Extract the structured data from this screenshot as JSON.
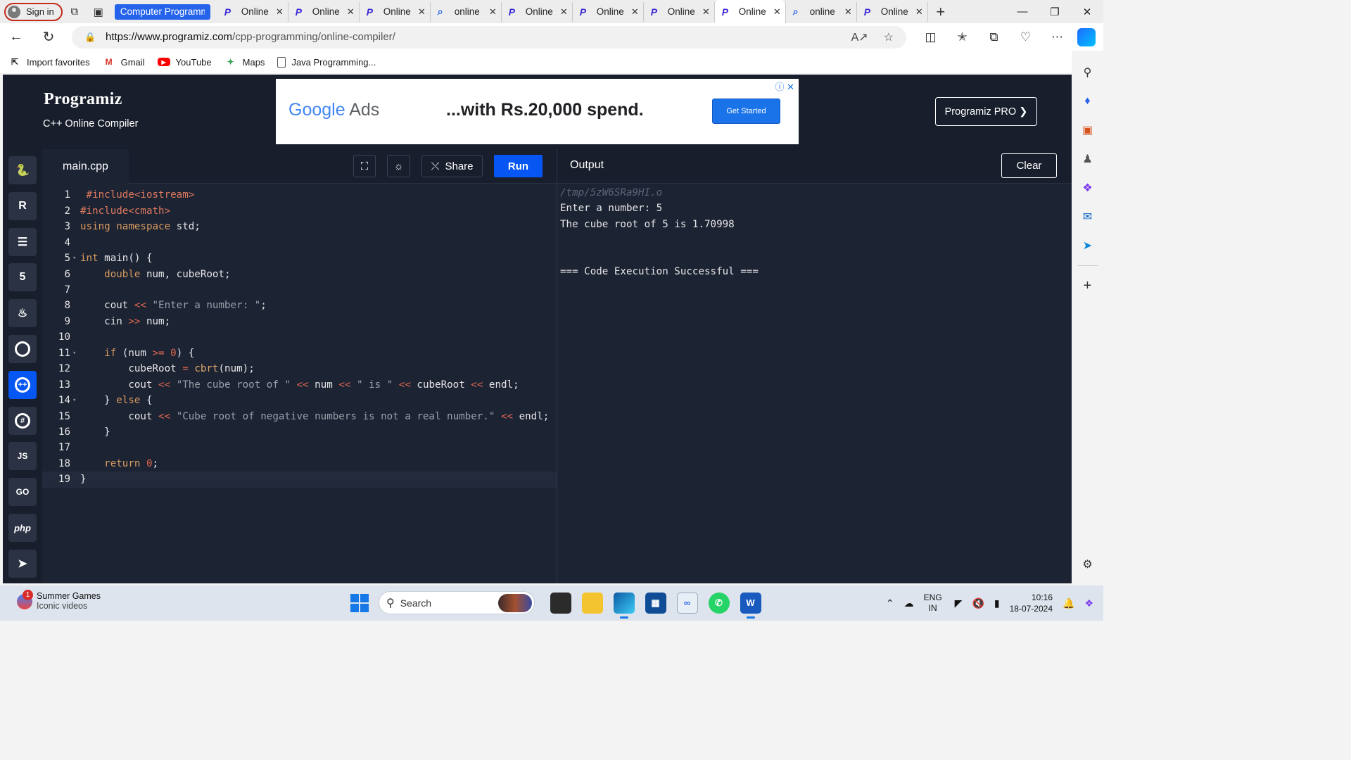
{
  "browser": {
    "signin_label": "Sign in",
    "tabs": [
      {
        "label": "Computer Programmin",
        "icon": "none",
        "style": "first"
      },
      {
        "label": "Online",
        "icon": "programiz"
      },
      {
        "label": "Online",
        "icon": "programiz"
      },
      {
        "label": "Online",
        "icon": "programiz"
      },
      {
        "label": "online",
        "icon": "search"
      },
      {
        "label": "Online",
        "icon": "programiz"
      },
      {
        "label": "Online",
        "icon": "programiz"
      },
      {
        "label": "Online",
        "icon": "programiz"
      },
      {
        "label": "Online",
        "icon": "programiz",
        "active": true
      },
      {
        "label": "online",
        "icon": "search"
      },
      {
        "label": "Online",
        "icon": "programiz"
      }
    ],
    "url_host": "https://www.programiz.com",
    "url_path": "/cpp-programming/online-compiler/",
    "bookmarks": [
      {
        "label": "Import favorites",
        "icon": "import-icon"
      },
      {
        "label": "Gmail",
        "icon": "gmail-icon"
      },
      {
        "label": "YouTube",
        "icon": "youtube-icon"
      },
      {
        "label": "Maps",
        "icon": "maps-icon"
      },
      {
        "label": "Java Programming...",
        "icon": "document-icon"
      }
    ]
  },
  "site": {
    "logo": "Programiz",
    "subtitle": "C++ Online Compiler",
    "pro_button": "Programiz PRO ❯",
    "ad": {
      "brand_google": "Google",
      "brand_ads": "Ads",
      "headline": "...with Rs.20,000 spend.",
      "cta": "Get Started"
    }
  },
  "languages": [
    {
      "name": "python",
      "glyph": "🐍",
      "active": false
    },
    {
      "name": "r",
      "glyph": "R",
      "active": false
    },
    {
      "name": "sql",
      "glyph": "☰",
      "active": false
    },
    {
      "name": "html",
      "glyph": "5",
      "active": false
    },
    {
      "name": "java",
      "glyph": "♨",
      "active": false
    },
    {
      "name": "c",
      "glyph": "C",
      "active": false
    },
    {
      "name": "cpp",
      "glyph": "C",
      "active": true
    },
    {
      "name": "csharp",
      "glyph": "C",
      "active": false
    },
    {
      "name": "js",
      "glyph": "JS",
      "active": false
    },
    {
      "name": "go",
      "glyph": "GO",
      "active": false
    },
    {
      "name": "php",
      "glyph": "php",
      "active": false
    },
    {
      "name": "swift",
      "glyph": "➤",
      "active": false
    }
  ],
  "editor": {
    "filename": "main.cpp",
    "share_label": "Share",
    "run_label": "Run",
    "current_line": 19,
    "lines": [
      {
        "n": "1",
        "fold": "",
        "html": " <span class=\"inc\">#include&lt;iostream&gt;</span>"
      },
      {
        "n": "2",
        "fold": "",
        "html": "<span class=\"inc\">#include&lt;cmath&gt;</span>"
      },
      {
        "n": "3",
        "fold": "",
        "html": "<span class=\"kw\">using namespace</span> std;"
      },
      {
        "n": "4",
        "fold": "",
        "html": ""
      },
      {
        "n": "5",
        "fold": "▾",
        "html": "<span class=\"kw\">int</span> main() {"
      },
      {
        "n": "6",
        "fold": "",
        "html": "    <span class=\"kw\">double</span> num, cubeRoot;"
      },
      {
        "n": "7",
        "fold": "",
        "html": ""
      },
      {
        "n": "8",
        "fold": "",
        "html": "    cout <span class=\"o\">&lt;&lt;</span> <span class=\"s\">\"Enter a number: \"</span>;"
      },
      {
        "n": "9",
        "fold": "",
        "html": "    cin <span class=\"o\">&gt;&gt;</span> num;"
      },
      {
        "n": "10",
        "fold": "",
        "html": ""
      },
      {
        "n": "11",
        "fold": "▾",
        "html": "    <span class=\"kw\">if</span> (num <span class=\"o\">&gt;=</span> <span class=\"n\">0</span>) {"
      },
      {
        "n": "12",
        "fold": "",
        "html": "        cubeRoot <span class=\"o\">=</span> <span class=\"k\">cbrt</span>(num);"
      },
      {
        "n": "13",
        "fold": "",
        "html": "        cout <span class=\"o\">&lt;&lt;</span> <span class=\"s\">\"The cube root of \"</span> <span class=\"o\">&lt;&lt;</span> num <span class=\"o\">&lt;&lt;</span> <span class=\"s\">\" is \"</span> <span class=\"o\">&lt;&lt;</span> cubeRoot <span class=\"o\">&lt;&lt;</span> endl;"
      },
      {
        "n": "14",
        "fold": "▾",
        "html": "    } <span class=\"kw\">else</span> {"
      },
      {
        "n": "15",
        "fold": "",
        "html": "        cout <span class=\"o\">&lt;&lt;</span> <span class=\"s\">\"Cube root of negative numbers is not a real number.\"</span> <span class=\"o\">&lt;&lt;</span> endl;"
      },
      {
        "n": "16",
        "fold": "",
        "html": "    }"
      },
      {
        "n": "17",
        "fold": "",
        "html": ""
      },
      {
        "n": "18",
        "fold": "",
        "html": "    <span class=\"kw\">return</span> <span class=\"n\">0</span>;"
      },
      {
        "n": "19",
        "fold": "",
        "html": "}"
      }
    ]
  },
  "output": {
    "title": "Output",
    "clear_label": "Clear",
    "lines": [
      {
        "text": "/tmp/5zW6SRa9HI.o",
        "kind": "path"
      },
      {
        "text": "Enter a number: 5",
        "kind": "normal"
      },
      {
        "text": "The cube root of 5 is 1.70998",
        "kind": "normal"
      },
      {
        "text": "",
        "kind": "normal"
      },
      {
        "text": "",
        "kind": "normal"
      },
      {
        "text": "=== Code Execution Successful ===",
        "kind": "normal"
      }
    ]
  },
  "taskbar": {
    "weather_badge": "1",
    "weather_title": "Summer Games",
    "weather_sub": "Iconic videos",
    "search_label": "Search",
    "lang_line1": "ENG",
    "lang_line2": "IN",
    "time": "10:16",
    "date": "18-07-2024"
  }
}
